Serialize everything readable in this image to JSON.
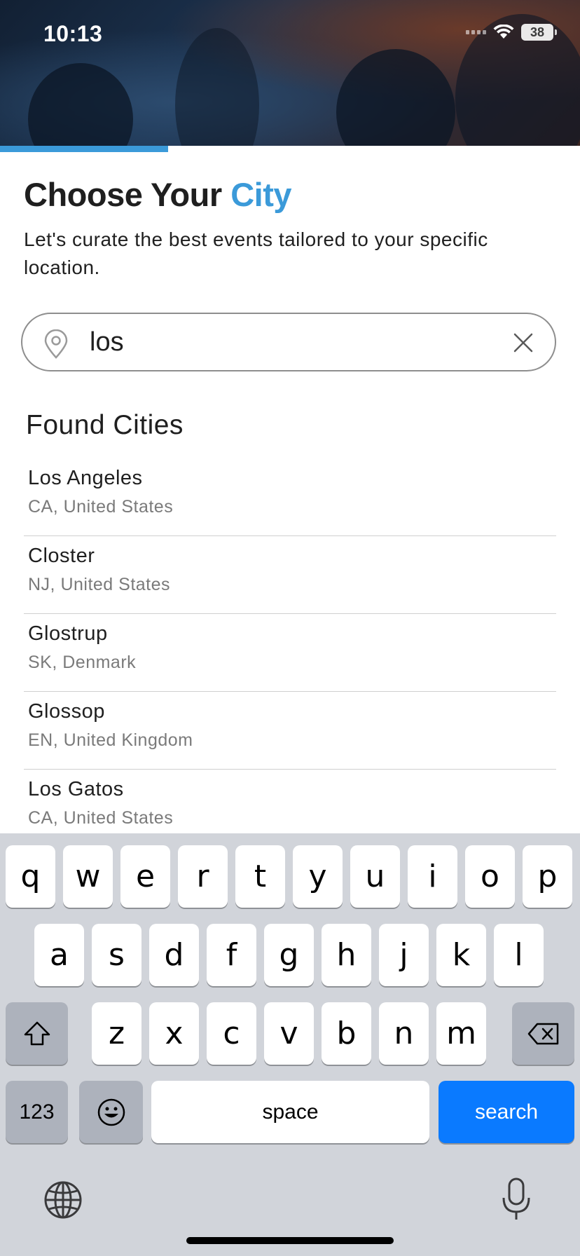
{
  "status_bar": {
    "time": "10:13",
    "battery": "38"
  },
  "progress": {
    "fraction": 0.29
  },
  "header": {
    "title_main": "Choose Your",
    "title_accent": "City",
    "subtitle": "Let's curate the best events tailored to your specific location."
  },
  "search": {
    "value": "los",
    "placeholder": ""
  },
  "results": {
    "title": "Found Cities",
    "items": [
      {
        "city": "Los Angeles",
        "region": "CA, United States"
      },
      {
        "city": "Closter",
        "region": "NJ, United States"
      },
      {
        "city": "Glostrup",
        "region": "SK, Denmark"
      },
      {
        "city": "Glossop",
        "region": "EN, United Kingdom"
      },
      {
        "city": "Los Gatos",
        "region": "CA, United States"
      }
    ]
  },
  "keyboard": {
    "row1": [
      "q",
      "w",
      "e",
      "r",
      "t",
      "y",
      "u",
      "i",
      "o",
      "p"
    ],
    "row2": [
      "a",
      "s",
      "d",
      "f",
      "g",
      "h",
      "j",
      "k",
      "l"
    ],
    "row3": [
      "z",
      "x",
      "c",
      "v",
      "b",
      "n",
      "m"
    ],
    "numbers_label": "123",
    "space_label": "space",
    "search_label": "search"
  },
  "colors": {
    "accent": "#3b9ad9",
    "search_key": "#0a7aff",
    "keyboard_bg": "#d1d4da"
  }
}
